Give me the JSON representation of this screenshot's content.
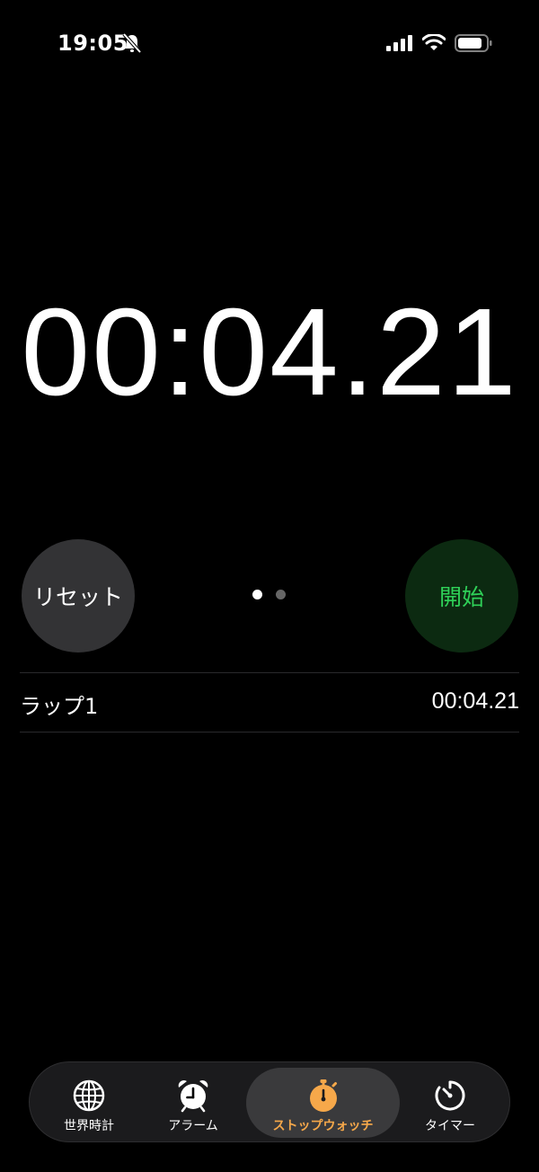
{
  "status_bar": {
    "time": "19:05",
    "icons": [
      "bell-slash-icon",
      "cellular-signal-icon",
      "wifi-icon",
      "battery-icon"
    ]
  },
  "stopwatch": {
    "display": "00:04.21"
  },
  "controls": {
    "reset_label": "リセット",
    "start_label": "開始",
    "page_indicator": {
      "count": 2,
      "active_index": 0
    }
  },
  "laps": [
    {
      "label": "ラップ1",
      "time": "00:04.21"
    }
  ],
  "tab_bar": {
    "active": "stopwatch",
    "tabs": [
      {
        "id": "world",
        "label": "世界時計",
        "icon": "globe-icon"
      },
      {
        "id": "alarm",
        "label": "アラーム",
        "icon": "alarm-clock-icon"
      },
      {
        "id": "stopwatch",
        "label": "ストップウォッチ",
        "icon": "stopwatch-icon"
      },
      {
        "id": "timer",
        "label": "タイマー",
        "icon": "timer-icon"
      }
    ]
  },
  "colors": {
    "background": "#000000",
    "reset_button_bg": "#333335",
    "start_button_bg": "#0c2a11",
    "start_button_text": "#2fd158",
    "accent_active_tab": "#f6a84a"
  }
}
